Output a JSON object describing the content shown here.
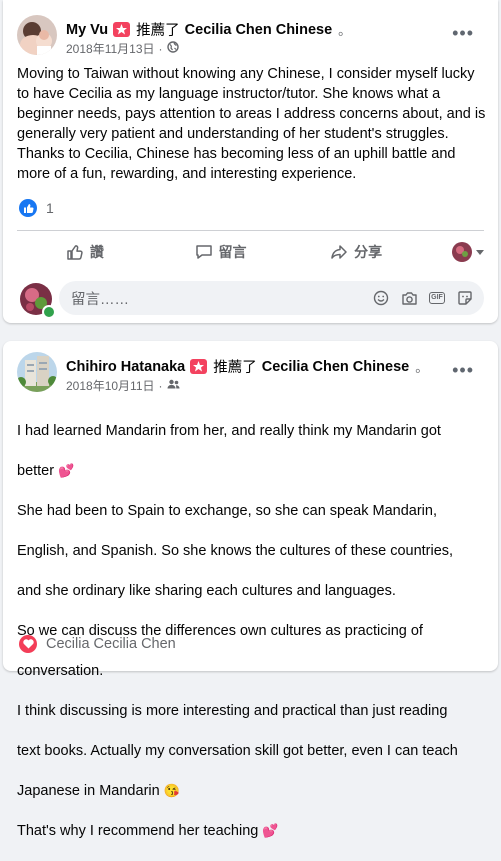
{
  "posts": [
    {
      "author": "My Vu",
      "recommends_text": "推薦了",
      "page_name": "Cecilia Chen Chinese",
      "separator": "。",
      "date": "2018年11月13日",
      "meta_separator": "·",
      "audience_icon": "globe-icon",
      "body": "Moving to Taiwan without knowing any Chinese, I consider myself lucky to have Cecilia as my language instructor/tutor. She knows what a beginner needs, pays attention to areas I address concerns about, and is generally very patient and understanding of her student's struggles. Thanks to Cecilia, Chinese has becoming less of an uphill battle and more of a fun, rewarding, and interesting experience.",
      "reaction_count": "1",
      "actions": {
        "like": "讚",
        "comment": "留言",
        "share": "分享"
      },
      "comment_placeholder": "留言……"
    },
    {
      "author": "Chihiro Hatanaka",
      "recommends_text": "推薦了",
      "page_name": "Cecilia Chen Chinese",
      "separator": "。",
      "date": "2018年10月11日",
      "meta_separator": "·",
      "audience_icon": "friends-icon",
      "body_lines": [
        "I had learned Mandarin from her, and really think my Mandarin got",
        "better",
        "She had been to Spain to exchange, so she can speak Mandarin,",
        "English, and Spanish. So she knows the cultures of these countries,",
        "and she ordinary like sharing each cultures and languages.",
        "So we can discuss the differences own cultures as practicing of",
        "conversation.",
        "I think discussing is more interesting and practical than just reading",
        "text books. Actually my conversation skill got better, even I can teach",
        "Japanese in Mandarin",
        "That's why I recommend her teaching"
      ],
      "reactor": "Cecilia Cecilia Chen"
    }
  ],
  "colors": {
    "brand_blue": "#1877f2",
    "recommend_red": "#f3425f",
    "online_green": "#31a24c",
    "love_red": "#f33e58"
  }
}
